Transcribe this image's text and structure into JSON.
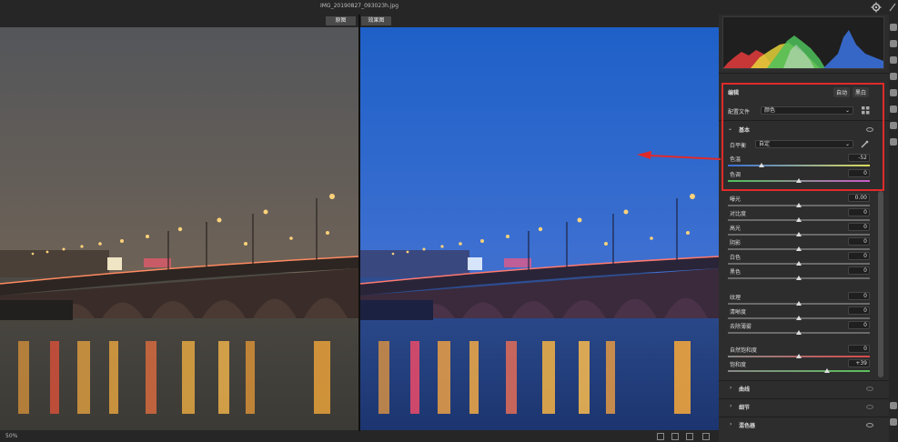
{
  "window": {
    "filename": "IMG_20190827_093023h.jpg"
  },
  "compare": {
    "before_label": "原图",
    "after_label": "效果图"
  },
  "bottom": {
    "zoom": "50%"
  },
  "panel": {
    "edit_title": "编辑",
    "auto_button": "自动",
    "bw_button": "黑白",
    "profile_label": "配置文件",
    "profile_value": "颜色",
    "basic_section": "基本",
    "wb_label": "白平衡",
    "wb_value": "自定",
    "sliders": [
      {
        "label": "色温",
        "value": "-52",
        "pos": 0.24,
        "track": "temp"
      },
      {
        "label": "色调",
        "value": "0",
        "pos": 0.5,
        "track": "tint"
      },
      {
        "label": "曝光",
        "value": "0.00",
        "pos": 0.5,
        "track": "gray"
      },
      {
        "label": "对比度",
        "value": "0",
        "pos": 0.5,
        "track": "gray"
      },
      {
        "label": "高光",
        "value": "0",
        "pos": 0.5,
        "track": "gray"
      },
      {
        "label": "阴影",
        "value": "0",
        "pos": 0.5,
        "track": "gray"
      },
      {
        "label": "白色",
        "value": "0",
        "pos": 0.5,
        "track": "gray"
      },
      {
        "label": "黑色",
        "value": "0",
        "pos": 0.5,
        "track": "gray"
      },
      {
        "label": "纹理",
        "value": "0",
        "pos": 0.5,
        "track": "gray"
      },
      {
        "label": "清晰度",
        "value": "0",
        "pos": 0.5,
        "track": "gray"
      },
      {
        "label": "去除薄雾",
        "value": "0",
        "pos": 0.5,
        "track": "gray"
      },
      {
        "label": "自然饱和度",
        "value": "0",
        "pos": 0.5,
        "track": "vib"
      },
      {
        "label": "饱和度",
        "value": "+39",
        "pos": 0.7,
        "track": "sat"
      }
    ],
    "sections": [
      {
        "label": "曲线"
      },
      {
        "label": "细节"
      },
      {
        "label": "混色器"
      }
    ]
  },
  "colors": {
    "highlight": "#e02a2a",
    "accent": "#2a7be0"
  }
}
